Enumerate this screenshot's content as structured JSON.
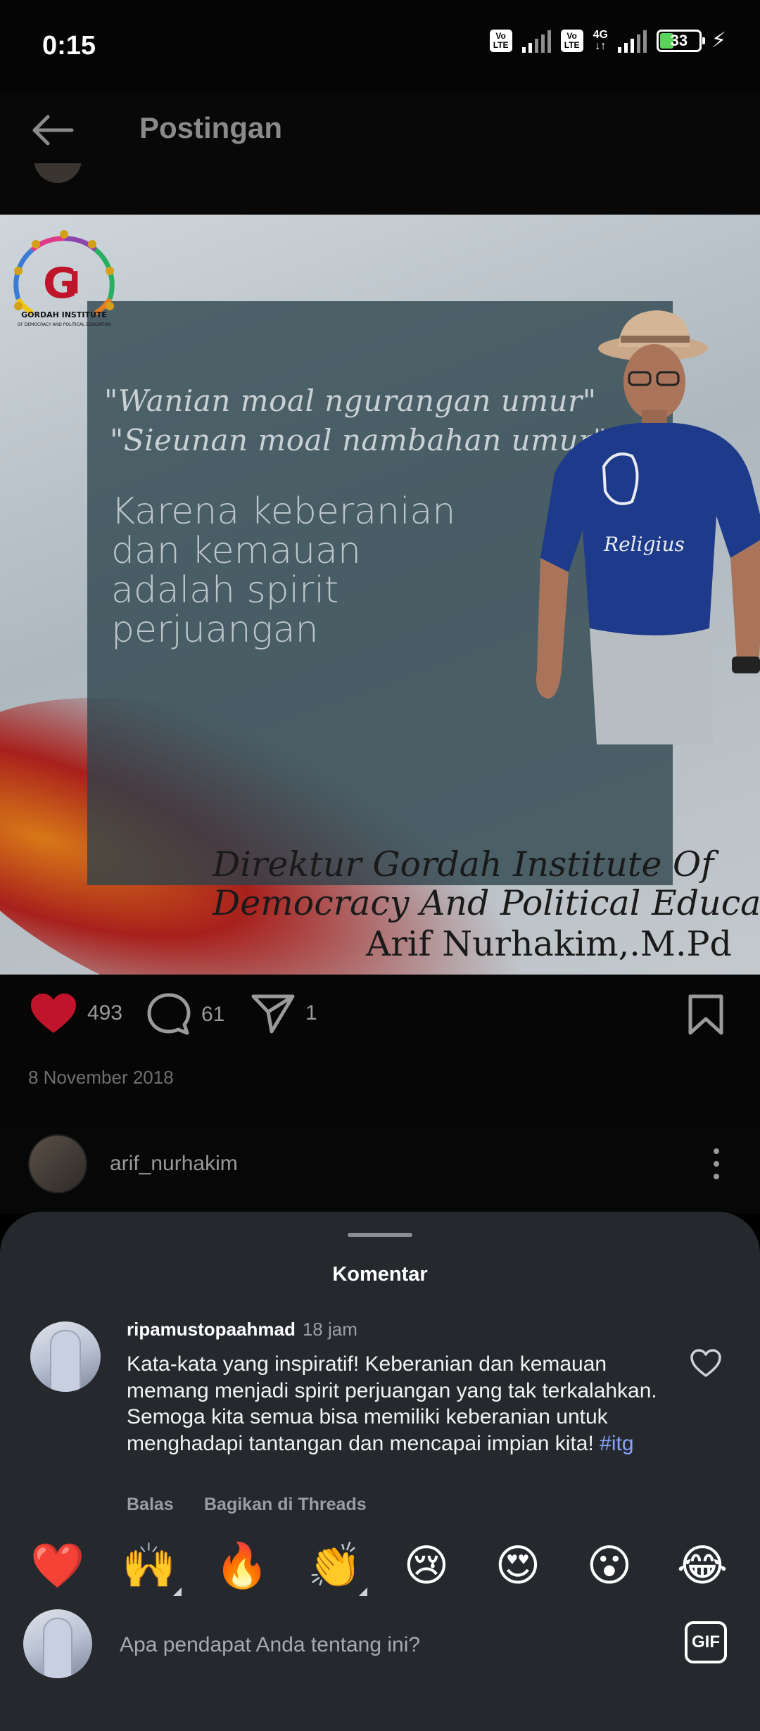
{
  "status_bar": {
    "time": "0:15",
    "volte_label": "Vo LTE",
    "network": "4G",
    "battery": "33",
    "battery_level": 0.33
  },
  "header": {
    "title": "Postingan"
  },
  "post_image": {
    "logo_text": "GORDAH INSTITUTE",
    "logo_subtext": "OF DEMOCRACY AND POLITICAL EDUCATION",
    "quote_line_1": "\"Wanian moal ngurangan umur\"",
    "quote_line_2": "\"Sieunan moal nambahan umur\"",
    "headline_lines": [
      "Karena keberanian",
      "dan kemauan",
      "adalah spirit",
      "perjuangan"
    ],
    "shirt_text": "Religius",
    "caption_line_1": "Direktur Gordah Institute Of",
    "caption_line_2": "Democracy And Political Education",
    "caption_line_3": "Arif Nurhakim,.M.Pd"
  },
  "actions": {
    "likes": "493",
    "comments": "61",
    "shares": "1"
  },
  "date": "8 November 2018",
  "author": {
    "username": "arif_nurhakim"
  },
  "comments_sheet": {
    "title": "Komentar",
    "comment": {
      "username": "ripamustopaahmad",
      "time": "18 jam",
      "text": "Kata-kata yang inspiratif!  Keberanian dan kemauan memang menjadi spirit perjuangan yang tak terkalahkan. Semoga kita semua bisa memiliki keberanian untuk menghadapi tantangan dan mencapai impian kita! ",
      "hashtag": "#itg",
      "reply_label": "Balas",
      "share_label": "Bagikan di Threads"
    },
    "emojis": [
      "❤️",
      "🙌",
      "🔥",
      "👏",
      "😢",
      "😍",
      "😮",
      "😂"
    ],
    "composer": {
      "placeholder": "Apa pendapat Anda tentang ini?",
      "gif_label": "GIF"
    }
  },
  "colors": {
    "like_red": "#c0142a",
    "sheet_bg": "#25282c",
    "hashtag": "#8aa3ff"
  }
}
